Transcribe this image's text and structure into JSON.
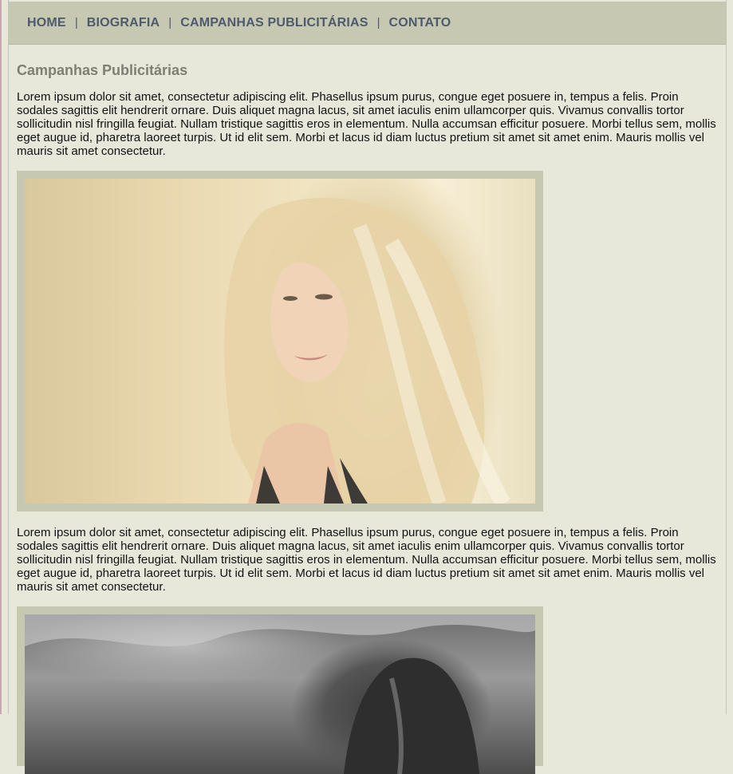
{
  "nav": {
    "items": [
      {
        "label": "HOME"
      },
      {
        "label": "BIOGRAFIA"
      },
      {
        "label": "CAMPANHAS PUBLICITÁRIAS"
      },
      {
        "label": "CONTATO"
      }
    ],
    "separator": "|"
  },
  "main": {
    "title": "Campanhas Publicitárias",
    "paragraph1": "Lorem ipsum dolor sit amet, consectetur adipiscing elit. Phasellus ipsum purus, congue eget posuere in, tempus a felis. Proin sodales sagittis elit hendrerit ornare. Duis aliquet magna lacus, sit amet iaculis enim ullamcorper quis. Vivamus convallis tortor sollicitudin nisl fringilla feugiat. Nullam tristique sagittis eros in elementum. Nulla accumsan efficitur posuere. Morbi tellus sem, mollis eget augue id, pharetra laoreet turpis. Ut id elit sem. Morbi et lacus id diam luctus pretium sit amet sit amet enim. Mauris mollis vel mauris sit amet consectetur.",
    "paragraph2": "Lorem ipsum dolor sit amet, consectetur adipiscing elit. Phasellus ipsum purus, congue eget posuere in, tempus a felis. Proin sodales sagittis elit hendrerit ornare. Duis aliquet magna lacus, sit amet iaculis enim ullamcorper quis. Vivamus convallis tortor sollicitudin nisl fringilla feugiat. Nullam tristique sagittis eros in elementum. Nulla accumsan efficitur posuere. Morbi tellus sem, mollis eget augue id, pharetra laoreet turpis. Ut id elit sem. Morbi et lacus id diam luctus pretium sit amet sit amet enim. Mauris mollis vel mauris sit amet consectetur."
  },
  "colors": {
    "nav_bg": "#c6c8b2",
    "nav_text": "#4d5a6e",
    "page_bg": "#e7e8da",
    "title": "#7e7e74"
  }
}
